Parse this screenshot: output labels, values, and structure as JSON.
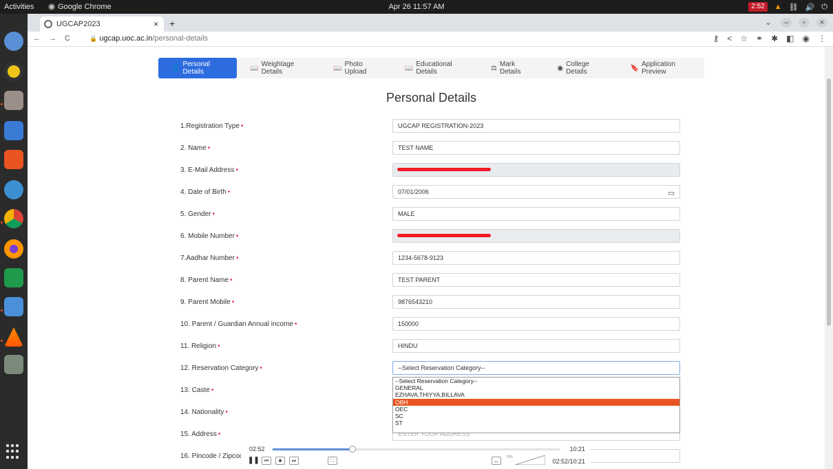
{
  "system": {
    "activities_label": "Activities",
    "app_name": "Google Chrome",
    "clock": "Apr 26  11:57 AM",
    "timer": "2:52"
  },
  "browser": {
    "tab_title": "UGCAP2023",
    "url_host": "ugcap.uoc.ac.in",
    "url_path": "/personal-details"
  },
  "steps": [
    {
      "icon": "user-icon",
      "glyph": "👤",
      "label": "Personal Details"
    },
    {
      "icon": "book-icon",
      "glyph": "📖",
      "label": "Weightage Details"
    },
    {
      "icon": "book-icon",
      "glyph": "📖",
      "label": "Photo Upload"
    },
    {
      "icon": "book-icon",
      "glyph": "📖",
      "label": "Educational Details"
    },
    {
      "icon": "scale-icon",
      "glyph": "⚖",
      "label": "Mark Details"
    },
    {
      "icon": "college-icon",
      "glyph": "◉",
      "label": "College Details"
    },
    {
      "icon": "preview-icon",
      "glyph": "🔖",
      "label": "Application Preview"
    }
  ],
  "form": {
    "title": "Personal Details",
    "required_mark": "•",
    "rows": [
      {
        "label": "1.Registration Type",
        "value": "UGCAP REGISTRATION-2023"
      },
      {
        "label": "2. Name",
        "value": "TEST NAME"
      },
      {
        "label": "3. E-Mail Address",
        "value": ""
      },
      {
        "label": "4. Date of Birth",
        "value": "07/01/2006"
      },
      {
        "label": "5. Gender",
        "value": "MALE"
      },
      {
        "label": "6. Mobile Number",
        "value": ""
      },
      {
        "label": "7.Aadhar Number",
        "value": "1234-5678-9123"
      },
      {
        "label": "8. Parent Name",
        "value": "TEST PARENT"
      },
      {
        "label": "9. Parent Mobile",
        "value": "9876543210"
      },
      {
        "label": "10. Parent / Guardian Annual income",
        "value": "150000"
      },
      {
        "label": "11. Religion",
        "value": "HINDU"
      },
      {
        "label": "12. Reservation Category",
        "value": "--Select Reservation Category--"
      },
      {
        "label": "13. Caste",
        "value": ""
      },
      {
        "label": "14. Nationality",
        "value": ""
      },
      {
        "label": "15. Address",
        "placeholder": "ENTER YOUR ADDRESS"
      },
      {
        "label": "16. Pincode / Zipcode",
        "placeholder": "ENTER YOUR VALID PINCODE"
      }
    ],
    "reservation_options": [
      "--Select Reservation Category--",
      "GENERAL",
      "EZHAVA,THIYYA,BILLAVA",
      "OBH",
      "OEC",
      "SC",
      "ST"
    ],
    "highlighted_option": "OBH"
  },
  "player": {
    "elapsed": "02:52",
    "duration": "10:21",
    "position": "02:52/10:21",
    "progress": 0.277,
    "volume_label": "0%"
  }
}
